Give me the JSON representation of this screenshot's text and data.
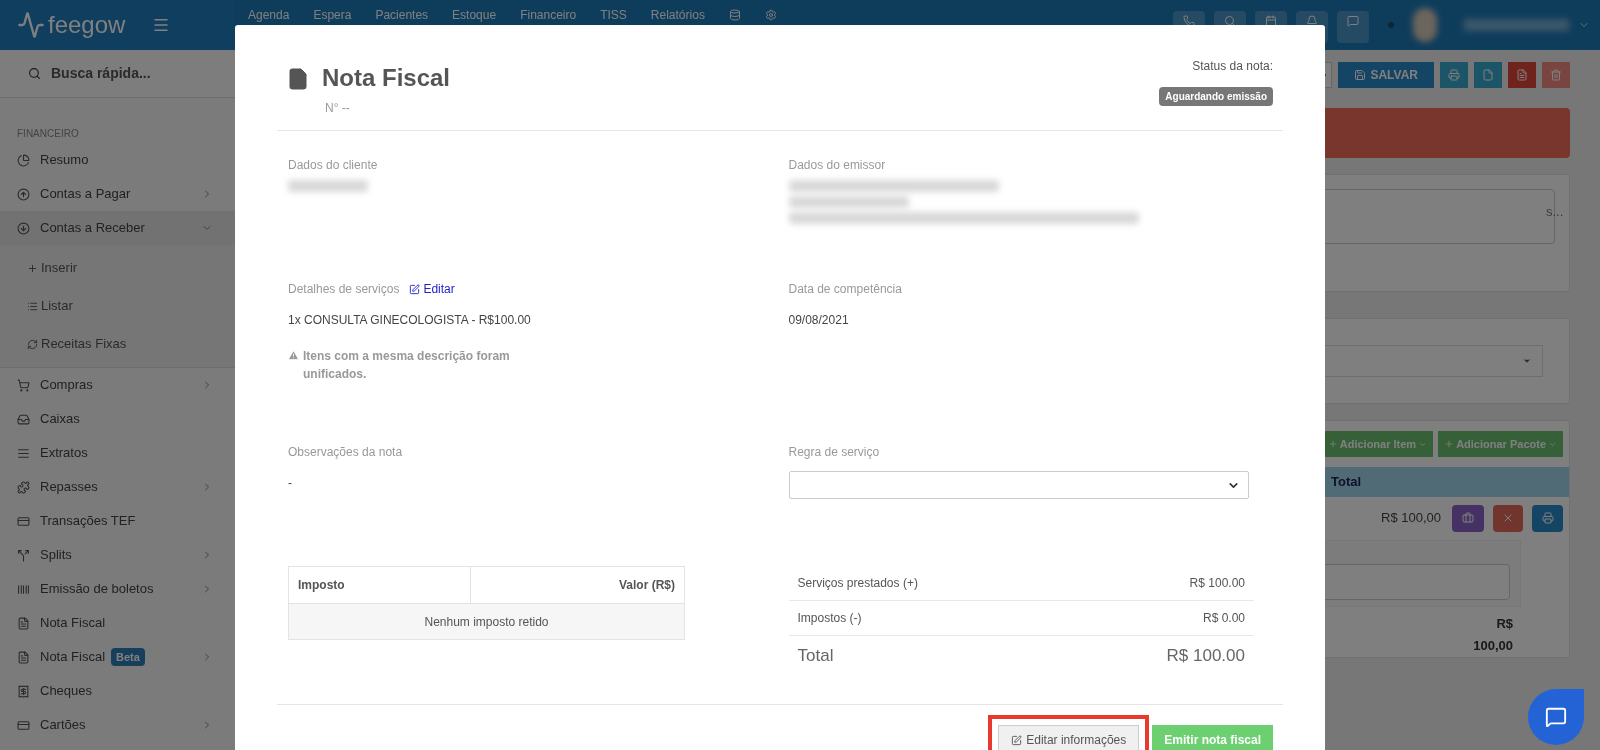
{
  "topbar": {
    "logo": "feegow",
    "nav": [
      "Agenda",
      "Espera",
      "Pacientes",
      "Estoque",
      "Financeiro",
      "TISS",
      "Relatórios"
    ]
  },
  "sidebar": {
    "search_placeholder": "Busca rápida...",
    "section": "FINANCEIRO",
    "items": [
      {
        "label": "Resumo"
      },
      {
        "label": "Contas a Pagar",
        "expanded": false
      },
      {
        "label": "Contas a Receber",
        "expanded": true,
        "children": [
          {
            "label": "Inserir"
          },
          {
            "label": "Listar"
          },
          {
            "label": "Receitas Fixas"
          }
        ]
      },
      {
        "label": "Compras",
        "expanded": false
      },
      {
        "label": "Caixas"
      },
      {
        "label": "Extratos"
      },
      {
        "label": "Repasses",
        "expanded": false
      },
      {
        "label": "Transações TEF"
      },
      {
        "label": "Splits",
        "expanded": false
      },
      {
        "label": "Emissão de boletos",
        "expanded": false
      },
      {
        "label": "Nota Fiscal"
      },
      {
        "label": "Nota Fiscal",
        "badge": "Beta",
        "expanded": false
      },
      {
        "label": "Cheques"
      },
      {
        "label": "Cartões",
        "expanded": false
      }
    ]
  },
  "background": {
    "save_button": "SALVAR",
    "notes_placeholder": "s...",
    "add_buttons": [
      "Adicionar Item",
      "Adicionar Pacote"
    ],
    "table_header": "Total",
    "row_value": "R$ 100,00",
    "total_value": "R$ 100,00"
  },
  "modal": {
    "title": "Nota Fiscal",
    "number": "N° --",
    "status_label": "Status da nota:",
    "status": "Aguardando emissão",
    "client_label": "Dados do cliente",
    "emitter_label": "Dados do emissor",
    "services_label": "Detalhes de serviços",
    "edit_link": "Editar",
    "services": [
      "1x CONSULTA GINECOLOGISTA - R$100.00"
    ],
    "warning": "Itens com a mesma descrição foram unificados.",
    "competence_label": "Data de competência",
    "competence": "09/08/2021",
    "notes_label": "Observações da nota",
    "notes": "-",
    "rule_label": "Regra de serviço",
    "tax_table": {
      "columns": [
        "Imposto",
        "Valor (R$)"
      ],
      "empty": "Nenhum imposto retido"
    },
    "summary": [
      {
        "label": "Serviços prestados (+)",
        "value": "R$ 100.00"
      },
      {
        "label": "Impostos (-)",
        "value": "R$ 0.00"
      }
    ],
    "total": {
      "label": "Total",
      "value": "R$ 100.00"
    },
    "buttons": [
      {
        "label": "Editar informações",
        "kind": "default",
        "highlighted": true
      },
      {
        "label": "Emitir nota fiscal",
        "kind": "success",
        "highlighted": false
      }
    ]
  }
}
